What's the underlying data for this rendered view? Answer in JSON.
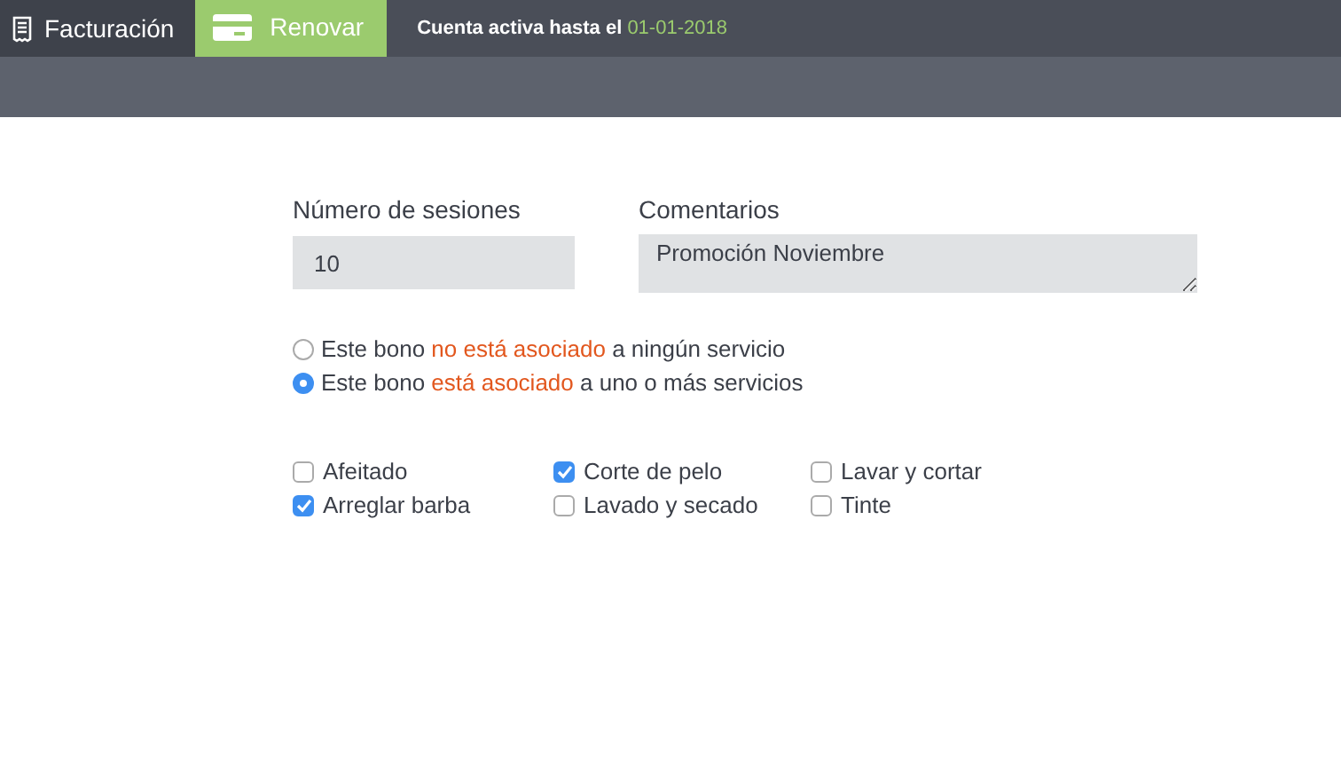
{
  "topbar": {
    "title": "Facturación",
    "renew_button": "Renovar",
    "account_notice": "Cuenta activa hasta el",
    "expiry_date": "01-01-2018"
  },
  "form": {
    "sessions": {
      "label": "Número de sesiones",
      "value": "10"
    },
    "comments": {
      "label": "Comentarios",
      "value": "Promoción Noviembre"
    }
  },
  "association_options": [
    {
      "before": "Este bono",
      "highlight": "no está asociado",
      "after": "a ningún servicio",
      "selected": false
    },
    {
      "before": "Este bono",
      "highlight": "está asociado",
      "after": "a uno o más servicios",
      "selected": true
    }
  ],
  "services": [
    {
      "label": "Afeitado",
      "checked": false
    },
    {
      "label": "Arreglar barba",
      "checked": true
    },
    {
      "label": "Corte de pelo",
      "checked": true
    },
    {
      "label": "Lavado y secado",
      "checked": false
    },
    {
      "label": "Lavar y cortar",
      "checked": false
    },
    {
      "label": "Tinte",
      "checked": false
    }
  ]
}
